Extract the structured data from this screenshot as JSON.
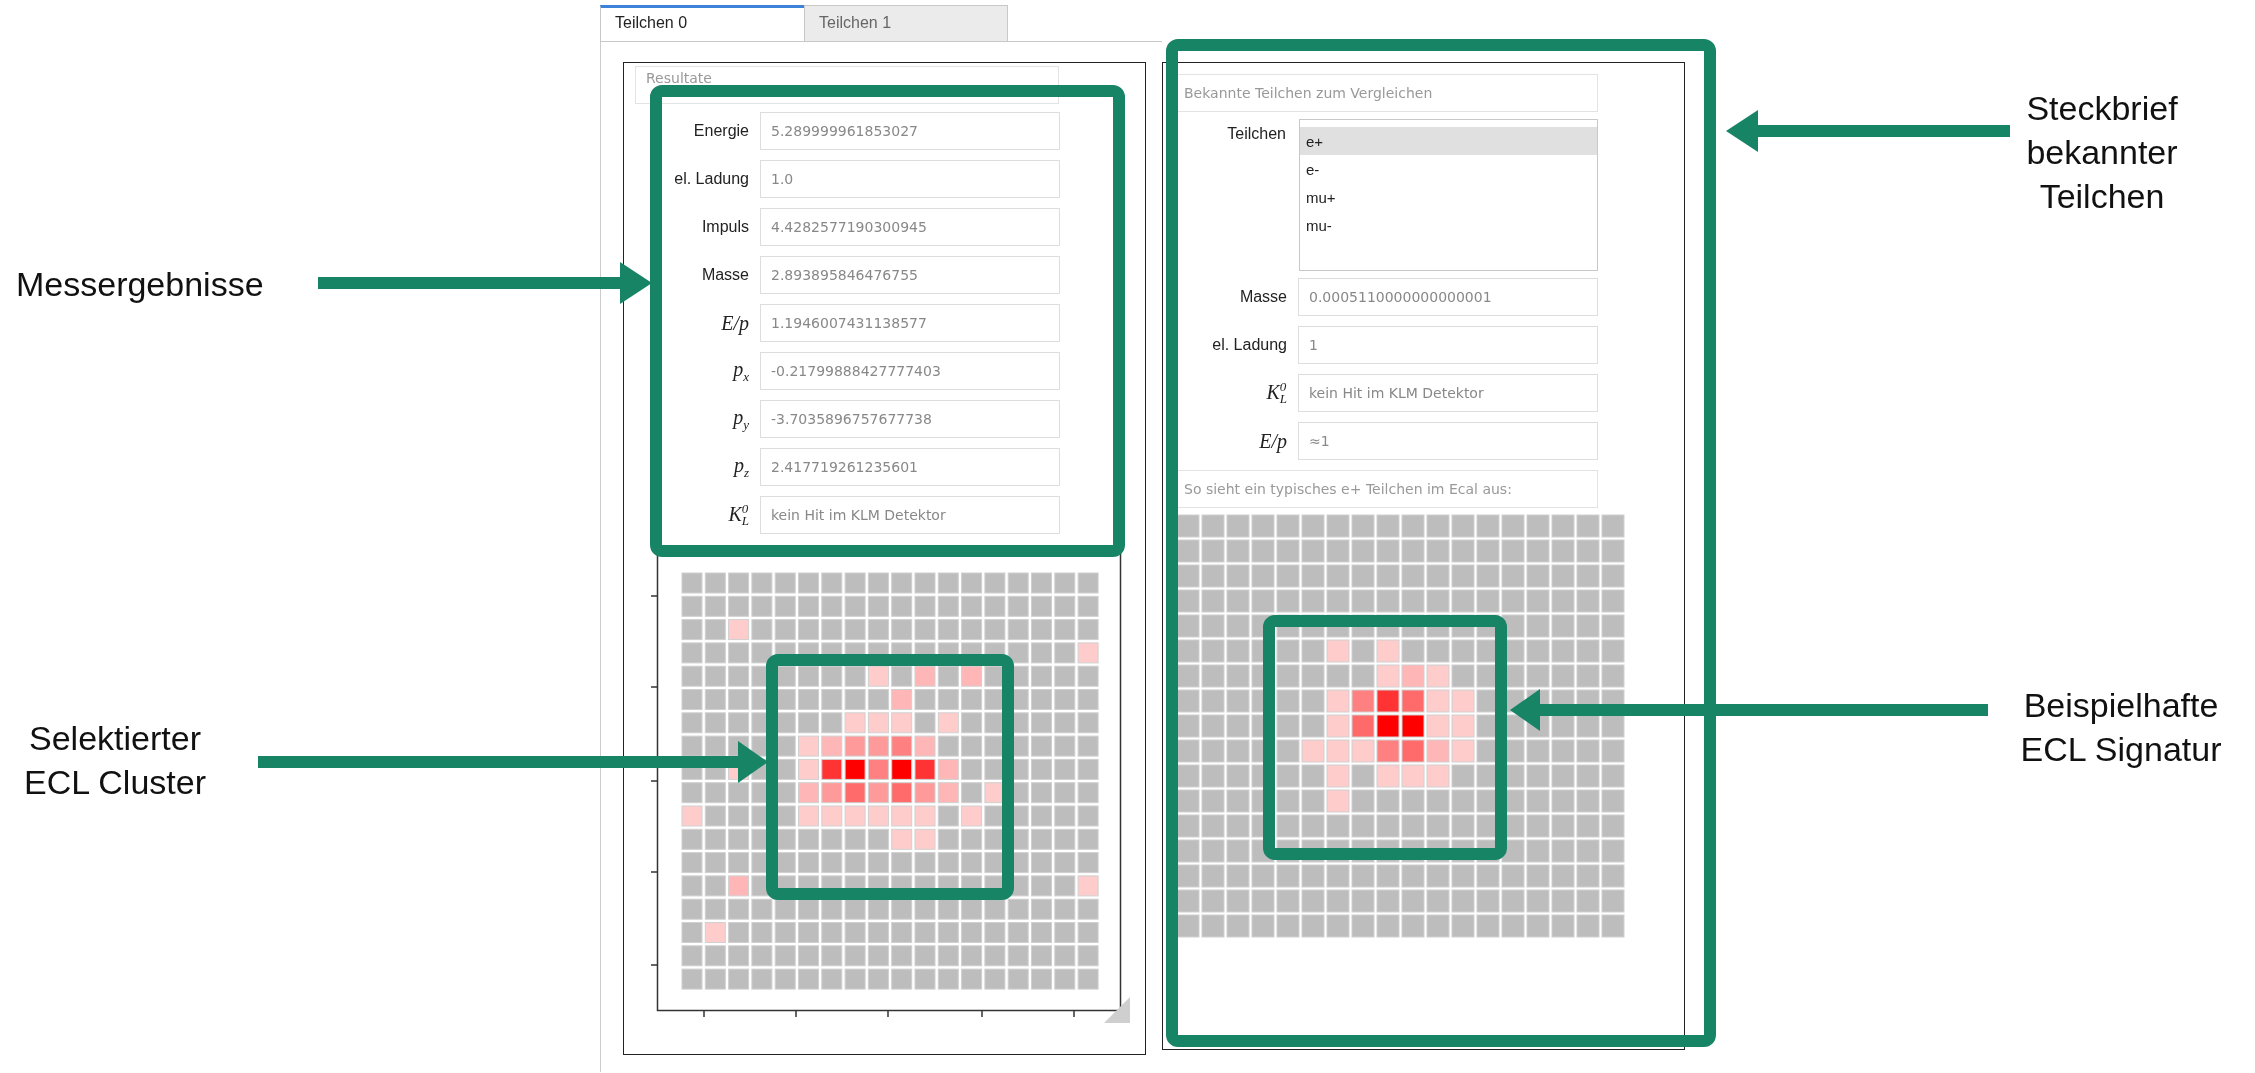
{
  "tabs": [
    {
      "label": "Teilchen 0",
      "selected": true
    },
    {
      "label": "Teilchen 1",
      "selected": false
    }
  ],
  "results_panel": {
    "header": "Resultate",
    "fields": [
      {
        "kind": "text",
        "label": "Energie",
        "value": "5.289999961853027"
      },
      {
        "kind": "text",
        "label": "el. Ladung",
        "value": "1.0"
      },
      {
        "kind": "text",
        "label": "Impuls",
        "value": "4.4282577190300945"
      },
      {
        "kind": "text",
        "label": "Masse",
        "value": "2.893895846476755"
      },
      {
        "kind": "math",
        "label": "E/p",
        "value": "1.1946007431138577"
      },
      {
        "kind": "math",
        "label": "p$_{x}$",
        "value": "-0.21799888427777403"
      },
      {
        "kind": "math",
        "label": "p$_{y}$",
        "value": "-3.7035896757677738"
      },
      {
        "kind": "math",
        "label": "p$_{z}$",
        "value": "2.417719261235601"
      },
      {
        "kind": "math",
        "label": "K$^{0}$$_{L}$",
        "value": "kein Hit im KLM Detektor"
      }
    ]
  },
  "comparison_panel": {
    "header": "Bekannte Teilchen zum Vergleichen",
    "particle_list": {
      "label": "Teilchen",
      "items": [
        {
          "label": "e+",
          "selected": true
        },
        {
          "label": "e-",
          "selected": false
        },
        {
          "label": "mu+",
          "selected": false
        },
        {
          "label": "mu-",
          "selected": false
        }
      ]
    },
    "fields": [
      {
        "kind": "text",
        "label": "Masse",
        "value": "0.0005110000000000001"
      },
      {
        "kind": "text",
        "label": "el. Ladung",
        "value": "1"
      },
      {
        "kind": "math",
        "label": "K$^{0}$$_{L}$",
        "value": "kein Hit im KLM Detektor"
      },
      {
        "kind": "math",
        "label": "E/p",
        "value": "≈1"
      }
    ],
    "caption": "So sieht ein typisches e+ Teilchen im Ecal aus:"
  },
  "annotations": [
    {
      "text": "Messergebnisse"
    },
    {
      "text": "Selektierter ECL Cluster"
    },
    {
      "text": "Steckbrief bekannter Teilchen"
    },
    {
      "text": "Beispielhafte ECL Signatur"
    }
  ]
}
